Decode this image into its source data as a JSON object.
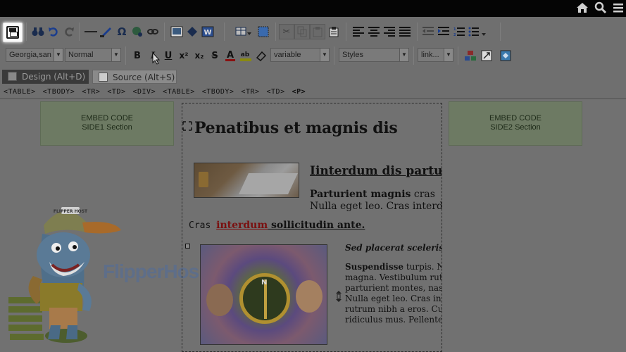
{
  "topbar": {
    "icons": [
      "home-icon",
      "search-icon",
      "menu-icon"
    ]
  },
  "toolbar": {
    "font_name": "Georgia,san",
    "paragraph_format": "Normal",
    "font_size": "variable",
    "styles": "Styles",
    "link": "link..."
  },
  "tabs": {
    "design": "Design (Alt+D)",
    "source": "Source (Alt+S)"
  },
  "breadcrumbs": [
    "<TABLE>",
    "<TBODY>",
    "<TR>",
    "<TD>",
    "<DIV>",
    "<TABLE>",
    "<TBODY>",
    "<TR>",
    "<TD>",
    "<P>"
  ],
  "content": {
    "side1_line1": "EMBED CODE",
    "side1_line2": "SIDE1 Section",
    "side2_line1": "EMBED CODE",
    "side2_line2": "SIDE2 Section",
    "heading": "Penatibus et magnis dis",
    "article_title": "Iinterdum dis partur",
    "para_bold": "Parturient magnis",
    "para_rest": " cras",
    "para_line2": "Nulla eget leo. Cras interdu",
    "sub_mono": "Cras ",
    "sub_red": "interdum",
    "sub_bold": " sollicitudin ante.",
    "compass_letter": "N",
    "right_em": "Sed placerat scelerisq",
    "right_bold": "Suspendisse",
    "right_l1_rest": " turpis. Nu",
    "right_l2": "magna. Vestibulum rut",
    "right_l3": "parturient montes, nasc",
    "right_l4": "Nulla eget leo. Cras inte",
    "right_l5": "rutrum nibh a eros. Cur",
    "right_l6": "ridiculus mus. Pellentes",
    "watermark": "FlipperHos",
    "mascot_cap_text": "FLIPPER HOST"
  },
  "colors": {
    "side_box": "#6d7a63",
    "editor_bg": "#6f6f6f",
    "topbar": "#050505"
  }
}
